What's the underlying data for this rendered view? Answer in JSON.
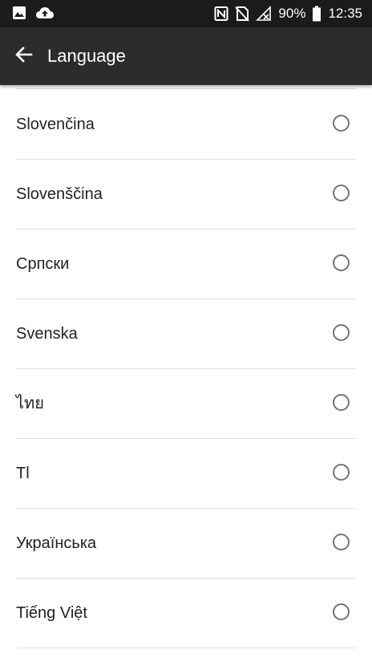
{
  "status_bar": {
    "battery": "90%",
    "time": "12:35",
    "icons": [
      "image-icon",
      "cloud-upload-icon",
      "nfc-icon",
      "no-sim-icon",
      "signal-off-icon",
      "battery-icon"
    ]
  },
  "app_bar": {
    "title": "Language",
    "back_icon": "arrow-back-icon"
  },
  "languages": [
    {
      "label": "Slovenčina",
      "selected": false
    },
    {
      "label": "Slovenščina",
      "selected": false
    },
    {
      "label": "Српски",
      "selected": false
    },
    {
      "label": "Svenska",
      "selected": false
    },
    {
      "label": "ไทย",
      "selected": false
    },
    {
      "label": "Tl",
      "selected": false
    },
    {
      "label": "Українська",
      "selected": false
    },
    {
      "label": "Tiếng Việt",
      "selected": false
    }
  ],
  "colors": {
    "status_bar": "#1b1b1b",
    "app_bar": "#2a2d2c",
    "divider": "#e0e0e0",
    "radio": "#737373"
  }
}
